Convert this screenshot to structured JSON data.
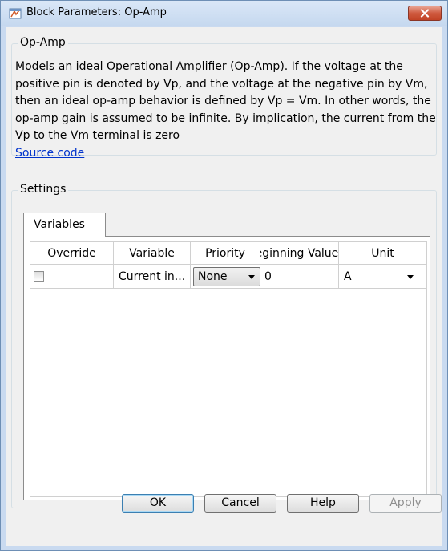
{
  "window": {
    "title": "Block Parameters: Op-Amp"
  },
  "block_group": {
    "legend": "Op-Amp",
    "description": "Models an ideal Operational Amplifier (Op-Amp). If the voltage at the positive pin is denoted by Vp, and the voltage at the negative pin by Vm, then an ideal op-amp behavior is defined by Vp = Vm. In other words, the op-amp gain is assumed to be infinite. By implication, the current from the Vp to the Vm terminal is zero",
    "source_link": "Source code"
  },
  "settings": {
    "legend": "Settings",
    "tab": "Variables",
    "table": {
      "headers": [
        "Override",
        "Variable",
        "Priority",
        "Beginning Value",
        "Unit"
      ],
      "rows": [
        {
          "override": false,
          "variable": "Current in...",
          "priority": "None",
          "beginning_value": "0",
          "unit": "A"
        }
      ]
    }
  },
  "buttons": {
    "ok": "OK",
    "cancel": "Cancel",
    "help": "Help",
    "apply": "Apply"
  },
  "colors": {
    "close_button": "#c8472c",
    "link": "#0033cc",
    "ok_border": "#3c7fb1"
  },
  "icons": {
    "app": "simscape-block-icon",
    "close": "close-icon"
  }
}
